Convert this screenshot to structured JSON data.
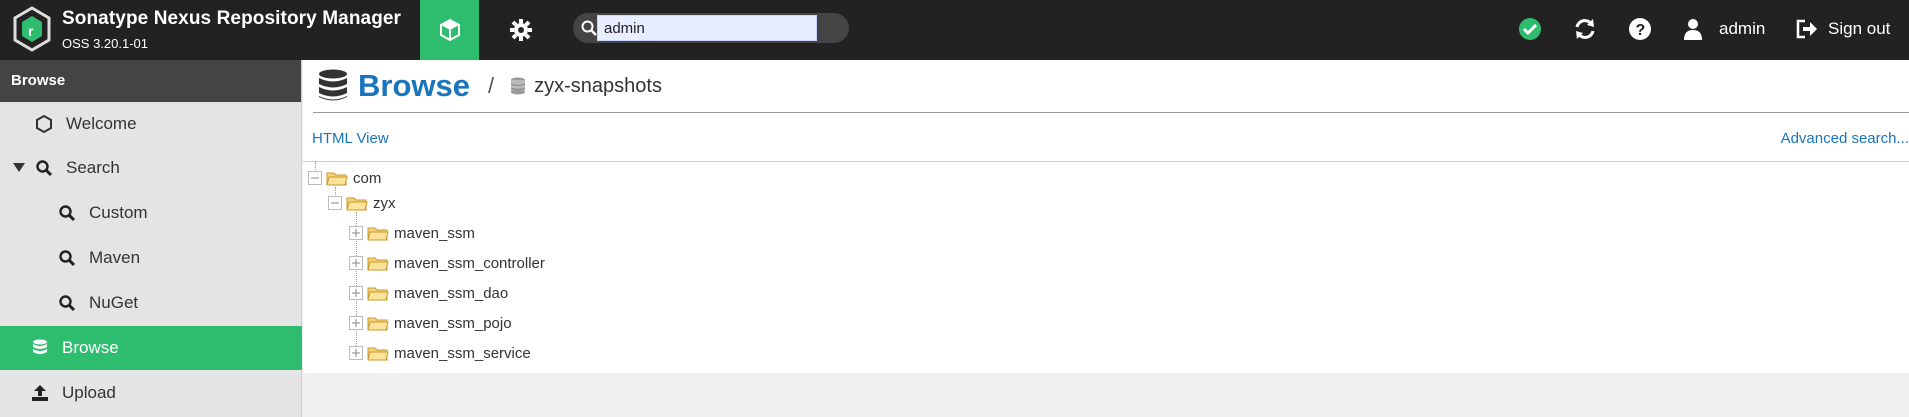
{
  "header": {
    "app_name": "Sonatype Nexus Repository Manager",
    "version": "OSS 3.20.1-01",
    "search": {
      "value": "admin",
      "placeholder": ""
    },
    "user_name": "admin",
    "signout_label": "Sign out",
    "brand_color": "#2ebd6f",
    "topbar_color": "#222222"
  },
  "sidebar": {
    "header": "Browse",
    "items": [
      {
        "label": "Welcome",
        "icon": "hexagon-icon",
        "active": false
      },
      {
        "label": "Search",
        "icon": "search-icon",
        "active": false,
        "expanded": true
      },
      {
        "label": "Custom",
        "icon": "search-icon",
        "active": false
      },
      {
        "label": "Maven",
        "icon": "search-icon",
        "active": false
      },
      {
        "label": "NuGet",
        "icon": "search-icon",
        "active": false
      },
      {
        "label": "Browse",
        "icon": "database-icon",
        "active": true
      },
      {
        "label": "Upload",
        "icon": "upload-icon",
        "active": false
      }
    ]
  },
  "main": {
    "title": "Browse",
    "separator": "/",
    "repository": "zyx-snapshots",
    "html_view_label": "HTML View",
    "advanced_search_label": "Advanced search...",
    "tree": {
      "root": "com",
      "child": "zyx",
      "leaves": [
        "maven_ssm",
        "maven_ssm_controller",
        "maven_ssm_dao",
        "maven_ssm_pojo",
        "maven_ssm_service"
      ]
    }
  }
}
